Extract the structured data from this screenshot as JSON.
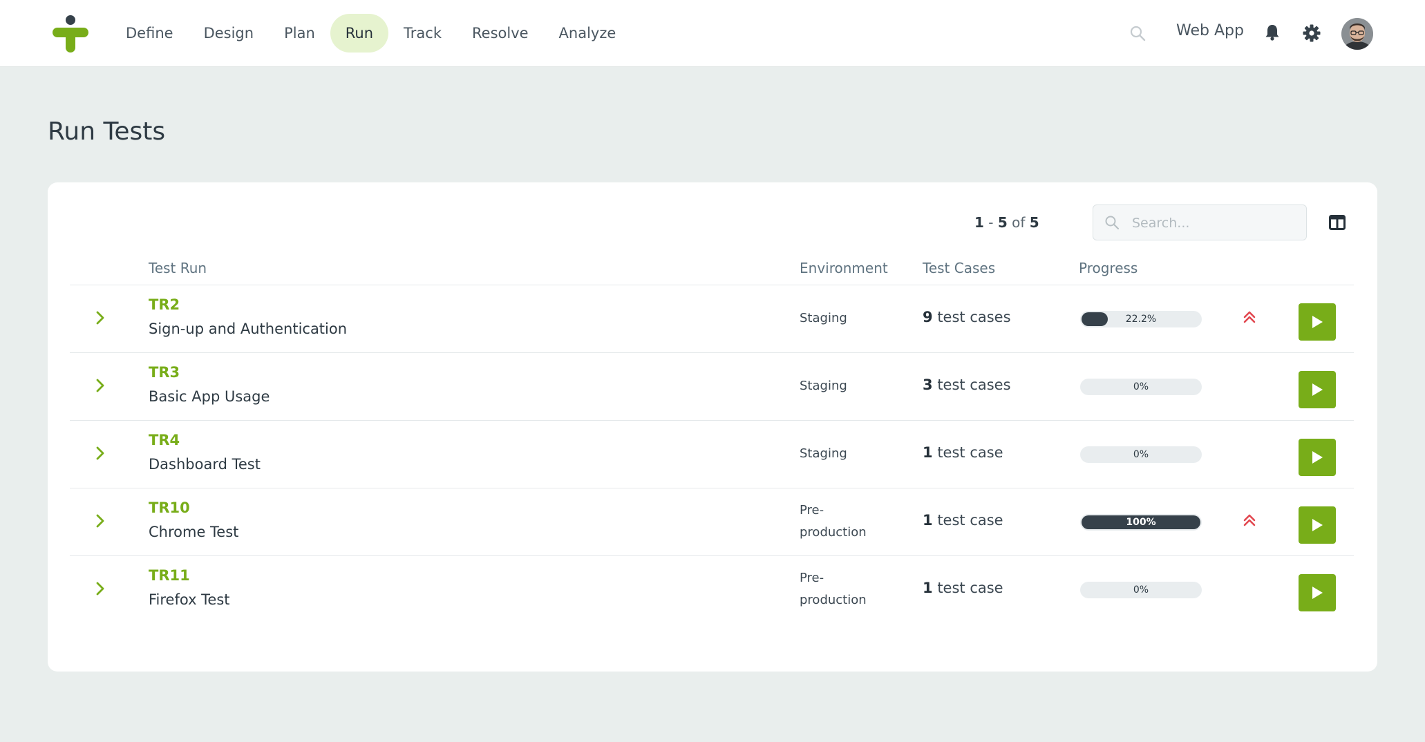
{
  "nav": {
    "items": [
      {
        "label": "Define"
      },
      {
        "label": "Design"
      },
      {
        "label": "Plan"
      },
      {
        "label": "Run",
        "active": true
      },
      {
        "label": "Track"
      },
      {
        "label": "Resolve"
      },
      {
        "label": "Analyze"
      }
    ],
    "project": "Web App"
  },
  "page": {
    "title": "Run Tests"
  },
  "toolbar": {
    "pager_from": "1",
    "pager_to": "5",
    "pager_of": "of",
    "pager_total": "5",
    "search_placeholder": "Search..."
  },
  "table": {
    "headers": {
      "test_run": "Test Run",
      "environment": "Environment",
      "test_cases": "Test Cases",
      "progress": "Progress"
    },
    "rows": [
      {
        "id": "TR2",
        "name": "Sign-up and Authentication",
        "env": [
          "Staging"
        ],
        "case_count": "9",
        "case_unit": "test cases",
        "progress_label": "22.2%",
        "progress": 0.222,
        "high_priority": true
      },
      {
        "id": "TR3",
        "name": "Basic App Usage",
        "env": [
          "Staging"
        ],
        "case_count": "3",
        "case_unit": "test cases",
        "progress_label": "0%",
        "progress": 0,
        "high_priority": false
      },
      {
        "id": "TR4",
        "name": "Dashboard Test",
        "env": [
          "Staging"
        ],
        "case_count": "1",
        "case_unit": "test case",
        "progress_label": "0%",
        "progress": 0,
        "high_priority": false
      },
      {
        "id": "TR10",
        "name": "Chrome Test",
        "env": [
          "Pre-",
          "production"
        ],
        "case_count": "1",
        "case_unit": "test case",
        "progress_label": "100%",
        "progress": 1,
        "high_priority": true
      },
      {
        "id": "TR11",
        "name": "Firefox Test",
        "env": [
          "Pre-",
          "production"
        ],
        "case_count": "1",
        "case_unit": "test case",
        "progress_label": "0%",
        "progress": 0,
        "high_priority": false
      }
    ]
  },
  "colors": {
    "brand_green": "#78ad19",
    "nav_active_bg": "#e6f3cf",
    "priority_red": "#e2474f",
    "progress_fill": "#36414a"
  },
  "icons": {
    "logo": "brand-logo-icon",
    "search": "search-icon",
    "notifications": "bell-icon",
    "settings": "gear-icon",
    "columns": "columns-icon",
    "expand": "chevron-right-icon",
    "priority": "double-chevron-up-icon",
    "run": "play-icon"
  }
}
